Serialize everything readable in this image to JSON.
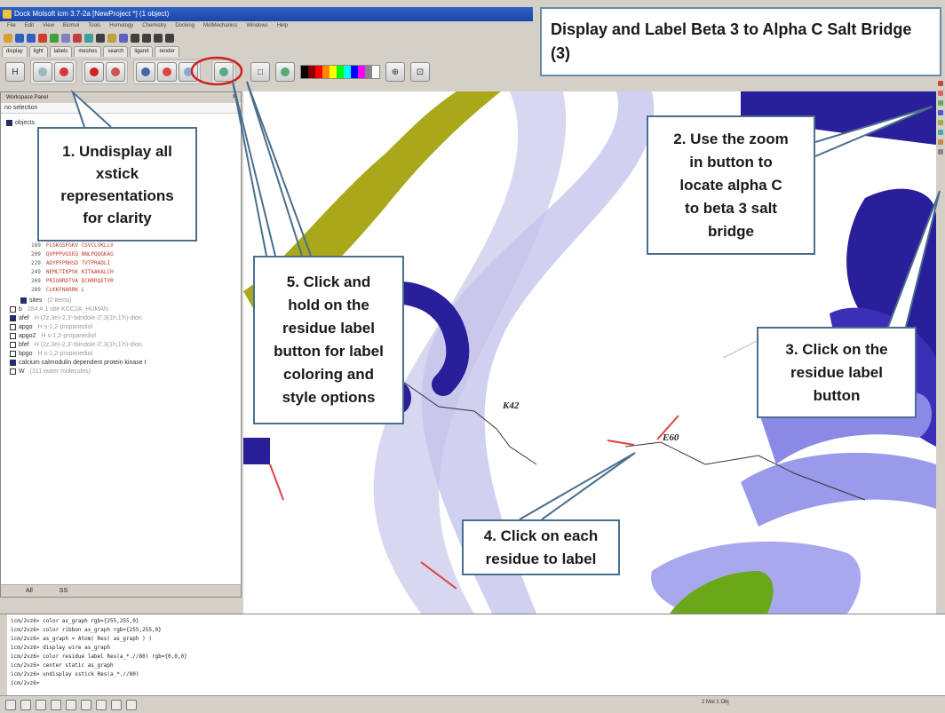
{
  "window": {
    "title": "Dock Molsoft icm 3.7-2a [NewProject *] (1 object)"
  },
  "menu": [
    "File",
    "Edit",
    "View",
    "Biomol",
    "Tools",
    "Homology",
    "Chemistry",
    "Docking",
    "MolMechanics",
    "Windows",
    "Help"
  ],
  "tabs": [
    "display",
    "light",
    "labels",
    "meshes",
    "search",
    "ligand",
    "render"
  ],
  "title_callout": "Display and Label Beta 3 to Alpha C Salt Bridge (3)",
  "workspace": {
    "header": "Workspace Panel",
    "selection": "no selection",
    "tree_top": "objects",
    "sequences": [
      {
        "num": "189",
        "seq": "FLGKGSFGKV CSVCLVKLLV"
      },
      {
        "num": "209",
        "seq": "QVPPPVGSEQ NNLPQQGKAG"
      },
      {
        "num": "229",
        "seq": "ADYPFPRHSD TVTPRADLI"
      },
      {
        "num": "249",
        "seq": "NEMLTIKPSK KITAAKALCH"
      },
      {
        "num": "269",
        "seq": "PRIGNRDTVA DCHRRQETVR"
      },
      {
        "num": "289",
        "seq": "CLKKFNARRK L"
      }
    ],
    "items": [
      {
        "name": "sites",
        "desc": "(2 items)"
      },
      {
        "name": "b",
        "desc": "284 A 1 site KCC2A_HUMAN"
      },
      {
        "name": "afef",
        "desc": "H  (2z,3e)-2,3'-biindole-2',3(1h,1'h)-dion"
      },
      {
        "name": "apgo",
        "desc": "H  s-1,2-propanediol"
      },
      {
        "name": "apgo2",
        "desc": "H  s-1,2-propanediol"
      },
      {
        "name": "bfef",
        "desc": "H  (2z,3e)-2,3'-biindole-2',3(1h,1'h)-dion"
      },
      {
        "name": "bpgo",
        "desc": "H  s-1,2-propanediol"
      },
      {
        "name": "calcium calmodulin dependent protein kinase t",
        "desc": ""
      },
      {
        "name": "W",
        "desc": "(311 water molecules)"
      }
    ],
    "bottom_tabs": [
      "All",
      "SS"
    ]
  },
  "labels": {
    "k42": "K42",
    "e60": "E60"
  },
  "callouts": {
    "c1": [
      "1. Undisplay all",
      "xstick",
      "representations",
      "for clarity"
    ],
    "c2": [
      "2. Use the zoom",
      "in button to",
      "locate alpha C",
      "to beta 3 salt",
      "bridge"
    ],
    "c3": [
      "3. Click on the",
      "residue label",
      "button"
    ],
    "c4": [
      "4. Click on each",
      "residue to label"
    ],
    "c5": [
      "5. Click and",
      "hold on the",
      "residue label",
      "button for label",
      "coloring and",
      "style options"
    ]
  },
  "console": [
    "icm/2vz6> color as_graph rgb={255,255,0}",
    "icm/2vz6> color ribbon as_graph rgb={255,255,0}",
    "icm/2vz6> as_graph = Atom( Res( as_graph ) )",
    "icm/2vz6> display wire as_graph",
    "icm/2vz6> color residue label Res(a_*.//80) rgb={0,0,0}",
    "icm/2vz6> center static as_graph",
    "icm/2vz6> undisplay xstick Res(a_*.//80)",
    "icm/2vz6>"
  ],
  "status": "2 Mol 1 Obj",
  "colors": {
    "ribbon_blue": "#2a1f9a",
    "ribbon_light": "#c8c8ee",
    "ribbon_mid": "#7f7fe0",
    "ribbon_yellow": "#a8a81a",
    "ribbon_green": "#6aa81a",
    "callout_border": "#4a6e8e",
    "highlight_circle": "#d22020"
  }
}
